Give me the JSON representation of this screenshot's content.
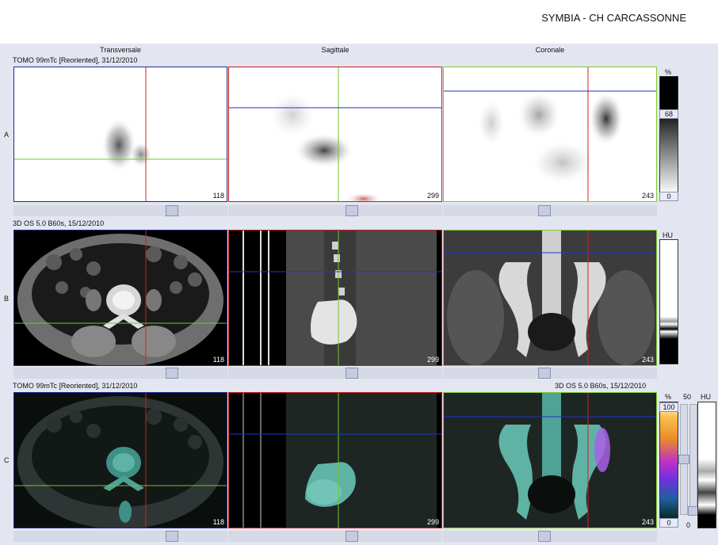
{
  "header": {
    "title": "SYMBIA - CH CARCASSONNE"
  },
  "columns": [
    "Transversale",
    "Sagittale",
    "Coronale"
  ],
  "rows": [
    {
      "letter": "A",
      "info_left": "TOMO 99mTc [Reoriented], 31/12/2010",
      "info_right": ""
    },
    {
      "letter": "B",
      "info_left": "3D  OS  5.0  B60s, 15/12/2010",
      "info_right": ""
    },
    {
      "letter": "C",
      "info_left": "TOMO 99mTc [Reoriented], 31/12/2010",
      "info_right": "3D  OS  5.0  B60s, 15/12/2010"
    }
  ],
  "slice_numbers": [
    "118",
    "299",
    "243"
  ],
  "scales": {
    "a": {
      "unit": "%",
      "marker": "68",
      "min": "0"
    },
    "b": {
      "unit": "HU"
    },
    "c": {
      "unit_pct": "%",
      "max": "100",
      "min": "0",
      "blend": "50",
      "blend_min": "0",
      "unit_hu": "HU"
    }
  },
  "colors": {
    "transversal_border": "#1c2a8c",
    "sagittal_border": "#c21f1f",
    "coronal_border": "#7ecb2f",
    "crosshair_red": "#d22020",
    "crosshair_green": "#6ec92b",
    "crosshair_blue": "#2233cc"
  }
}
